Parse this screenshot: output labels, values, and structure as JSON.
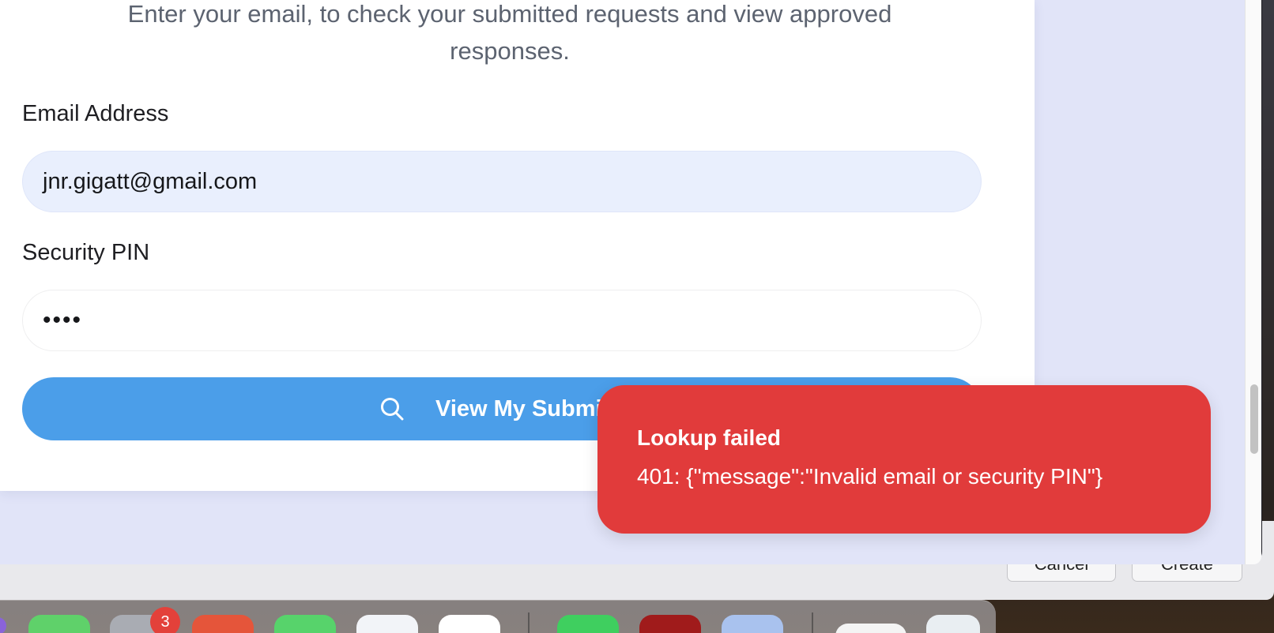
{
  "card": {
    "subtitle_line1": "Enter your email, to check your submitted requests and view approved",
    "subtitle_line2": "responses."
  },
  "form": {
    "email": {
      "label": "Email Address",
      "value": "jnr.gigatt@gmail.com"
    },
    "pin": {
      "label": "Security PIN",
      "value": "••••"
    },
    "submit": {
      "label": "View My Submissions",
      "icon": "search-icon"
    }
  },
  "toast": {
    "title": "Lookup failed",
    "message": "401: {\"message\":\"Invalid email or security PIN\"}",
    "color": "#e13b3b"
  },
  "background_dialog": {
    "cancel_label": "Cancel",
    "create_label": "Create"
  },
  "dock": {
    "badge_count": "3",
    "items": [
      "messages-icon",
      "system-settings-icon",
      "browser-icon",
      "facetime-icon",
      "safari-icon",
      "preview-icon",
      "whatsapp-icon",
      "acrobat-icon",
      "finder-folder-icon",
      "document-icon",
      "trash-icon"
    ]
  },
  "colors": {
    "primary_button": "#4b9ee9",
    "email_input_bg": "#e9effd",
    "page_bg": "#e1e4f8",
    "toast_bg": "#e13b3b"
  }
}
